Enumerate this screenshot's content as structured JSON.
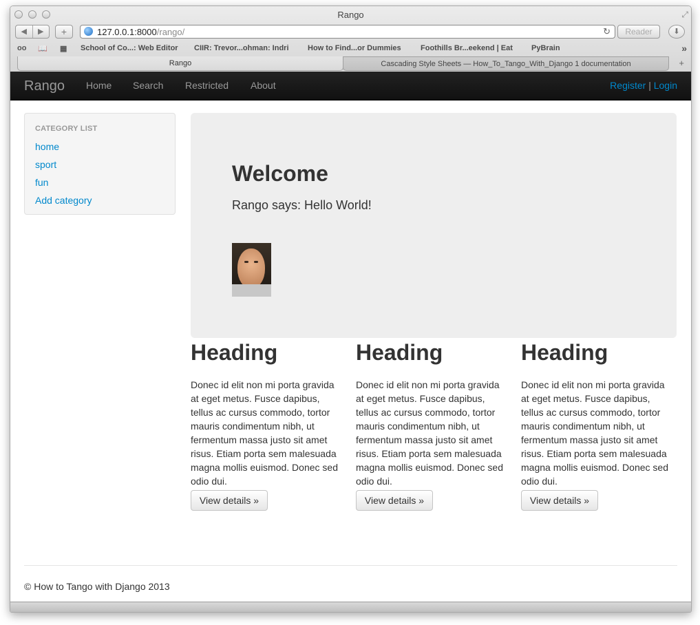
{
  "window": {
    "title": "Rango"
  },
  "toolbar": {
    "back_icon": "◀",
    "forward_icon": "▶",
    "add_icon": "+",
    "url_host": "127.0.0.1:8000",
    "url_path": "/rango/",
    "reload_icon": "↻",
    "reader_label": "Reader",
    "download_icon": "⬇"
  },
  "bookmarks": {
    "reading_list_icon": "oo",
    "book_icon": "📖",
    "grid_icon": "▦",
    "items": [
      "School of Co...: Web Editor",
      "CIIR: Trevor...ohman: Indri",
      "How to Find...or Dummies",
      "Foothills Br...eekend | Eat",
      "PyBrain"
    ],
    "more_icon": "»"
  },
  "tabs": [
    {
      "label": "Rango"
    },
    {
      "label": "Cascading Style Sheets — How_To_Tango_With_Django 1 documentation"
    }
  ],
  "tab_add_icon": "+",
  "navbar": {
    "brand": "Rango",
    "links": [
      "Home",
      "Search",
      "Restricted",
      "About"
    ],
    "register": "Register",
    "separator": "|",
    "login": "Login"
  },
  "sidebar": {
    "header": "CATEGORY LIST",
    "links": [
      "home",
      "sport",
      "fun",
      "Add category"
    ]
  },
  "hero": {
    "title": "Welcome",
    "text": "Rango says: Hello World!"
  },
  "columns": [
    {
      "heading": "Heading",
      "text": "Donec id elit non mi porta gravida at eget metus. Fusce dapibus, tellus ac cursus commodo, tortor mauris condimentum nibh, ut fermentum massa justo sit amet risus. Etiam porta sem malesuada magna mollis euismod. Donec sed odio dui.",
      "button": "View details »"
    },
    {
      "heading": "Heading",
      "text": "Donec id elit non mi porta gravida at eget metus. Fusce dapibus, tellus ac cursus commodo, tortor mauris condimentum nibh, ut fermentum massa justo sit amet risus. Etiam porta sem malesuada magna mollis euismod. Donec sed odio dui.",
      "button": "View details »"
    },
    {
      "heading": "Heading",
      "text": "Donec id elit non mi porta gravida at eget metus. Fusce dapibus, tellus ac cursus commodo, tortor mauris condimentum nibh, ut fermentum massa justo sit amet risus. Etiam porta sem malesuada magna mollis euismod. Donec sed odio dui.",
      "button": "View details »"
    }
  ],
  "footer": {
    "text": "© How to Tango with Django 2013"
  },
  "colors": {
    "navbar_bg": "#1b1b1b",
    "link": "#0088cc",
    "hero_bg": "#eeeeee",
    "sidebar_bg": "#f5f5f5"
  }
}
